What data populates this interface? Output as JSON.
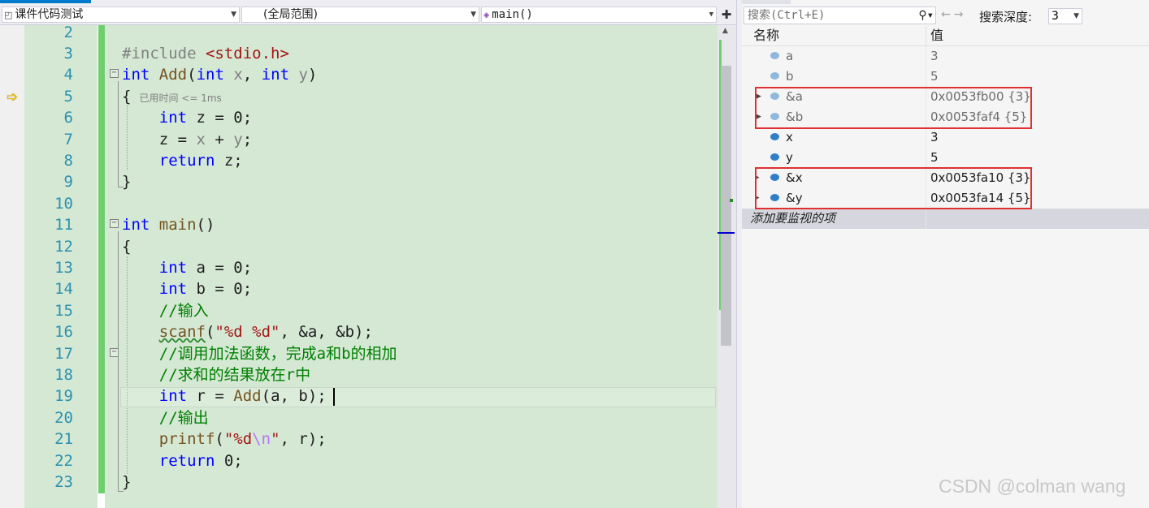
{
  "editor": {
    "nav": {
      "project": "课件代码测试",
      "scope": "(全局范围)",
      "member": "main()"
    },
    "lines": [
      {
        "no": "2"
      },
      {
        "no": "3"
      },
      {
        "no": "4"
      },
      {
        "no": "5",
        "timing": "已用时间 <= 1ms"
      },
      {
        "no": "6"
      },
      {
        "no": "7"
      },
      {
        "no": "8"
      },
      {
        "no": "9"
      },
      {
        "no": "10"
      },
      {
        "no": "11"
      },
      {
        "no": "12"
      },
      {
        "no": "13"
      },
      {
        "no": "14"
      },
      {
        "no": "15",
        "comment": "//输入"
      },
      {
        "no": "16"
      },
      {
        "no": "17",
        "comment": "//调用加法函数，完成a和b的相加"
      },
      {
        "no": "18",
        "comment": "//求和的结果放在r中"
      },
      {
        "no": "19"
      },
      {
        "no": "20",
        "comment": "//输出"
      },
      {
        "no": "21"
      },
      {
        "no": "22"
      },
      {
        "no": "23"
      }
    ]
  },
  "watch": {
    "search_placeholder": "搜索(Ctrl+E)",
    "depth_label": "搜索深度:",
    "depth_value": "3",
    "col_name": "名称",
    "col_value": "值",
    "rows": [
      {
        "name": "a",
        "value": "3"
      },
      {
        "name": "b",
        "value": "5"
      },
      {
        "name": "&a",
        "value": "0x0053fb00 {3}"
      },
      {
        "name": "&b",
        "value": "0x0053faf4 {5}"
      },
      {
        "name": "x",
        "value": "3"
      },
      {
        "name": "y",
        "value": "5"
      },
      {
        "name": "&x",
        "value": "0x0053fa10 {3}"
      },
      {
        "name": "&y",
        "value": "0x0053fa14 {5}"
      }
    ],
    "add_item": "添加要监视的项"
  },
  "watermark": "CSDN @colman wang",
  "colors": {
    "editor_bg": "#d4e8d4",
    "keyword": "#0000ff",
    "string": "#a31515",
    "comment": "#008000",
    "line_number": "#2b91af",
    "highlight_box": "#e03030"
  }
}
